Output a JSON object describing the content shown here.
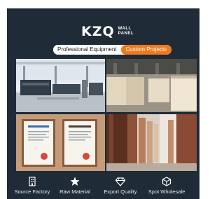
{
  "brand": {
    "logo_mark": "KZQ",
    "logo_line1": "WALL",
    "logo_line2": "PANEL"
  },
  "tags": {
    "primary": "Professional Equipment",
    "secondary": "Custom Projects"
  },
  "features": [
    {
      "label": "Source Factory",
      "icon": "factory-building-icon"
    },
    {
      "label": "Raw Material",
      "icon": "star-icon"
    },
    {
      "label": "Export Quality",
      "icon": "diamond-icon"
    },
    {
      "label": "Spot Wholesale",
      "icon": "box-icon"
    }
  ],
  "colors": {
    "background": "#1f2b36",
    "accent": "#ef7a1e",
    "text": "#ffffff"
  }
}
